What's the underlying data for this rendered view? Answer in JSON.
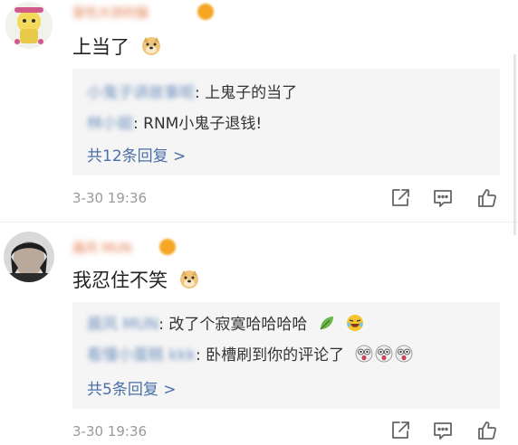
{
  "comments": [
    {
      "username": "爱吃大饼的猫",
      "text": "上当了",
      "emoji": "doge-emoji",
      "replies": [
        {
          "user": "小鬼子讲故事呢",
          "colon": ": ",
          "text": "上鬼子的当了"
        },
        {
          "user": "林小姐",
          "colon": ": ",
          "text": "RNM小鬼子退钱!"
        }
      ],
      "more": "共12条回复 >",
      "time": "3-30 19:36"
    },
    {
      "username": "晨风 MUN",
      "text": "我忍住不笑",
      "emoji": "doge-emoji",
      "replies": [
        {
          "user": "晨风 MUN",
          "colon": ": ",
          "text": "改了个寂寞哈哈哈哈"
        },
        {
          "user": "看懂小蛋糕 kkk",
          "colon": ": ",
          "text": "卧槽刷到你的评论了"
        }
      ],
      "more": "共5条回复 >",
      "time": "3-30 19:36"
    }
  ],
  "actions": [
    "share-icon",
    "comment-icon",
    "like-icon"
  ],
  "colors": {
    "link": "#4a6fa8",
    "reply_bg": "#f5f5f5",
    "meta": "#9a9a9a"
  }
}
